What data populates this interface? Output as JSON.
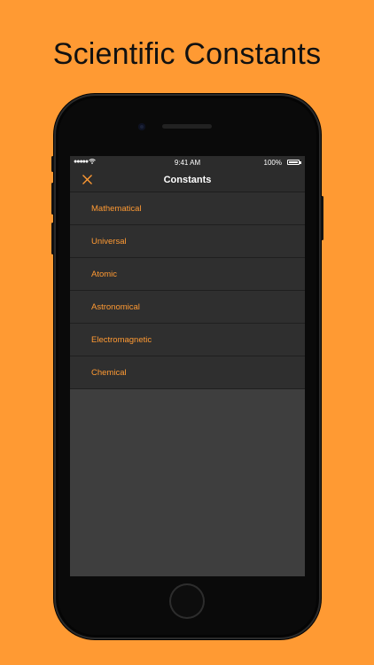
{
  "headline": "Scientific Constants",
  "status_bar": {
    "signal": "●●●●● ",
    "wifi_icon": "wifi-icon",
    "time": "9:41 AM",
    "battery": "100%"
  },
  "nav": {
    "title": "Constants",
    "close_icon": "close-icon"
  },
  "categories": [
    "Mathematical",
    "Universal",
    "Atomic",
    "Astronomical",
    "Electromagnetic",
    "Chemical"
  ],
  "colors": {
    "accent": "#FF9A33",
    "background": "#FF9A33",
    "screen_bg": "#3e3e3e",
    "row_bg": "#2f2f2f"
  }
}
